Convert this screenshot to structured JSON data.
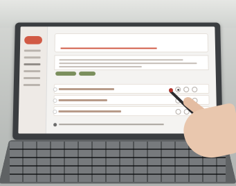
{
  "colors": {
    "accent": "#d15a45",
    "button": "#cf4f3a",
    "chip": "#7b8f5d"
  },
  "sidebar": {
    "item_count_visible": 6
  },
  "question_rows": 4
}
